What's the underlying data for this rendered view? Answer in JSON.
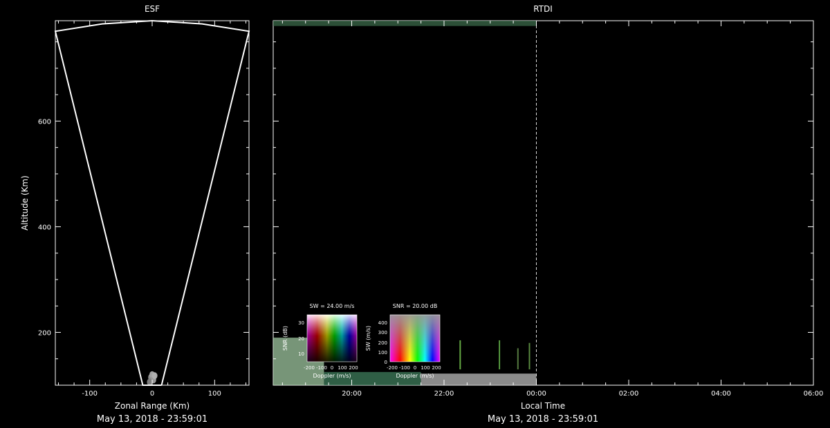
{
  "chart_data": [
    {
      "type": "scatter",
      "title": "ESF",
      "xlabel": "Zonal Range (Km)",
      "ylabel": "Altitude (Km)",
      "xlim": [
        -155,
        155
      ],
      "ylim": [
        100,
        790
      ],
      "xticks": [
        -100,
        0,
        100
      ],
      "yticks": [
        200,
        400,
        600
      ],
      "footer": "May 13, 2018 - 23:59:01",
      "fan_outline": {
        "left_edge": [
          [
            -15,
            100
          ],
          [
            -155,
            770
          ]
        ],
        "right_edge": [
          [
            15,
            100
          ],
          [
            155,
            770
          ]
        ],
        "top_arc": [
          [
            -155,
            770
          ],
          [
            -80,
            784
          ],
          [
            0,
            790
          ],
          [
            80,
            784
          ],
          [
            155,
            770
          ]
        ]
      },
      "echo_points": [
        {
          "x": -2,
          "y": 115,
          "color": "#8f8f8f"
        },
        {
          "x": 0,
          "y": 120,
          "color": "#a3a3a3"
        },
        {
          "x": 2,
          "y": 110,
          "color": "#9a9a9a"
        },
        {
          "x": -4,
          "y": 106,
          "color": "#7e7e7e"
        },
        {
          "x": 4,
          "y": 118,
          "color": "#b0b0b0"
        }
      ]
    },
    {
      "type": "heatmap",
      "title": "RTDI",
      "xlabel": "Local Time",
      "xlim": [
        18.3,
        30
      ],
      "ylim": [
        100,
        790
      ],
      "xticks": [
        20,
        22,
        24,
        26,
        28,
        30
      ],
      "xtick_labels": [
        "20:00",
        "22:00",
        "00:00",
        "02:00",
        "04:00",
        "06:00"
      ],
      "yticks": [
        200,
        400,
        600
      ],
      "current_time": 24.0,
      "footer": "May 13, 2018 - 23:59:01",
      "echo_layers": [
        {
          "t0": 18.3,
          "t1": 19.4,
          "alt0": 100,
          "alt1": 190,
          "color": "#9fc7a0"
        },
        {
          "t0": 19.4,
          "t1": 21.5,
          "alt0": 100,
          "alt1": 125,
          "color": "#3f7d5c"
        },
        {
          "t0": 21.5,
          "t1": 24.0,
          "alt0": 100,
          "alt1": 122,
          "color": "#b8b8b8"
        },
        {
          "t0": 18.3,
          "t1": 24.0,
          "alt0": 780,
          "alt1": 790,
          "color": "#3b6a4a"
        }
      ],
      "echo_streaks": [
        {
          "t": 22.35,
          "alt0": 130,
          "alt1": 185,
          "color": "#66aa44"
        },
        {
          "t": 23.2,
          "alt0": 130,
          "alt1": 185,
          "color": "#55993f"
        },
        {
          "t": 23.6,
          "alt0": 130,
          "alt1": 170,
          "color": "#557a3f"
        },
        {
          "t": 23.85,
          "alt0": 130,
          "alt1": 180,
          "color": "#5a8a40"
        }
      ],
      "legends": [
        {
          "label": "SW = 24.00 m/s",
          "ylabel": "SNR (dB)",
          "xlabel": "Doppler (m/s)",
          "xticks": [
            "-200",
            "-100",
            "0",
            "100",
            "200"
          ],
          "yticks": [
            "10",
            "20",
            "30"
          ]
        },
        {
          "label": "SNR = 20.00 dB",
          "ylabel": "SW (m/s)",
          "xlabel": "Doppler (m/s)",
          "xticks": [
            "-200",
            "-100",
            "0",
            "100",
            "200"
          ],
          "yticks": [
            "0",
            "100",
            "200",
            "300",
            "400"
          ]
        }
      ]
    }
  ]
}
